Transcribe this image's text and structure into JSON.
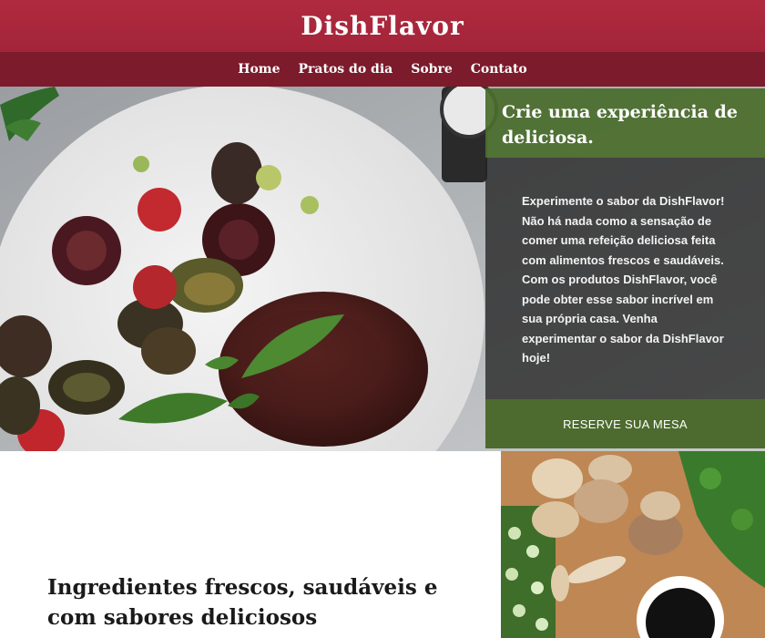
{
  "header": {
    "brand": "DishFlavor"
  },
  "nav": {
    "items": [
      "Home",
      "Pratos do dia",
      "Sobre",
      "Contato"
    ]
  },
  "hero": {
    "card_title": "Crie uma experiência de deliciosa.",
    "card_text": "Experimente o sabor da DishFlavor! Não há nada como a sensação de comer uma refeição deliciosa feita com alimentos frescos e saudáveis. Com os produtos DishFlavor, você pode obter esse sabor incrível em sua própria casa. Venha experimentar o sabor da DishFlavor hoje!",
    "button_label": "RESERVE SUA MESA"
  },
  "section": {
    "title": "Ingredientes frescos, saudáveis e com sabores deliciosos"
  },
  "colors": {
    "brand_red": "#a3243a",
    "nav_dark_red": "#7b1b2b",
    "accent_green": "#4d6b2e"
  }
}
